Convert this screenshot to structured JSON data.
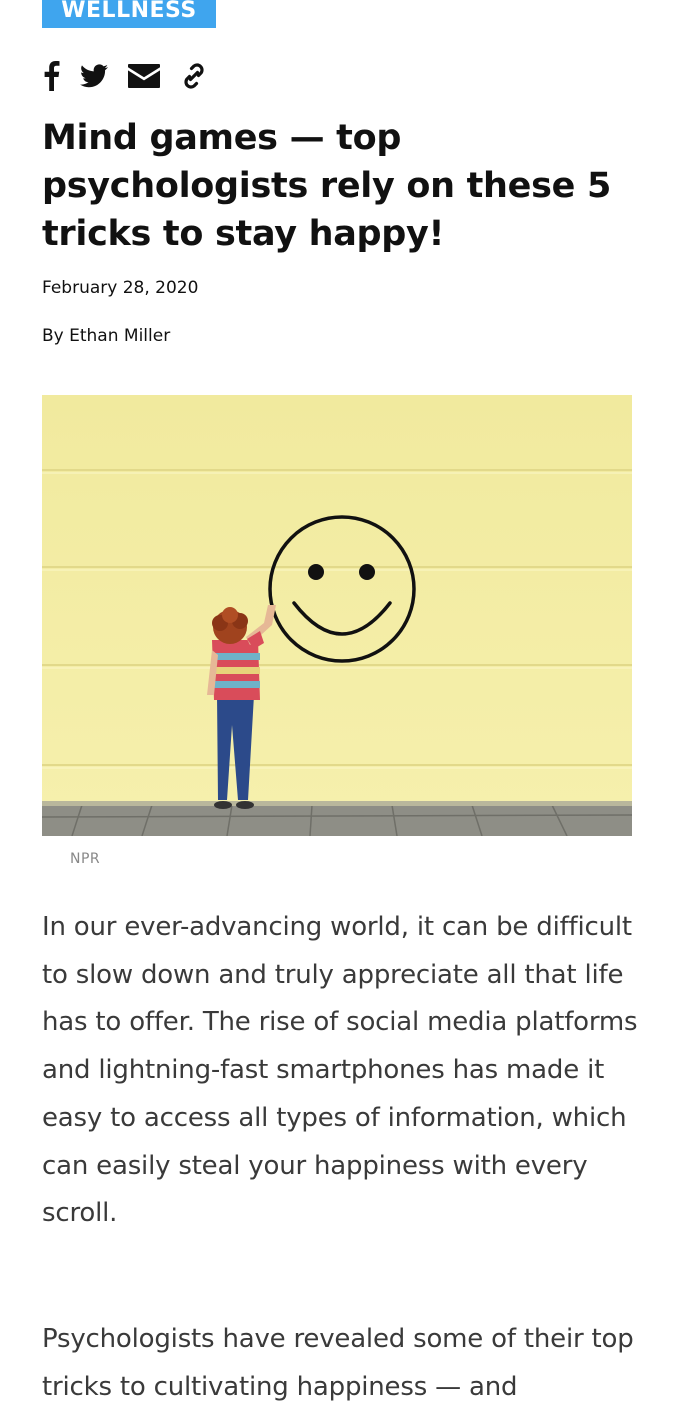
{
  "article": {
    "category": "WELLNESS",
    "title": "Mind games — top psychologists rely on these 5 tricks to stay happy!",
    "date": "February 28, 2020",
    "byline": "By Ethan Miller",
    "image_caption": "NPR",
    "paragraphs": [
      "In our ever-advancing world, it can be difficult to slow down and truly appreciate all that life has to offer. The rise of social media platforms and lightning-fast smartphones has made it easy to access all types of information, which can easily steal your happiness with every scroll.",
      "Psychologists have revealed some of their top tricks to cultivating happiness — and"
    ]
  },
  "share": {
    "icons": [
      "facebook-icon",
      "twitter-icon",
      "email-icon",
      "link-icon"
    ]
  },
  "colors": {
    "badge_bg": "#3fa5ee",
    "headline": "#111111",
    "body_text": "#3a3a3a",
    "caption": "#888888",
    "hero_wall": "#f3ec9f"
  }
}
